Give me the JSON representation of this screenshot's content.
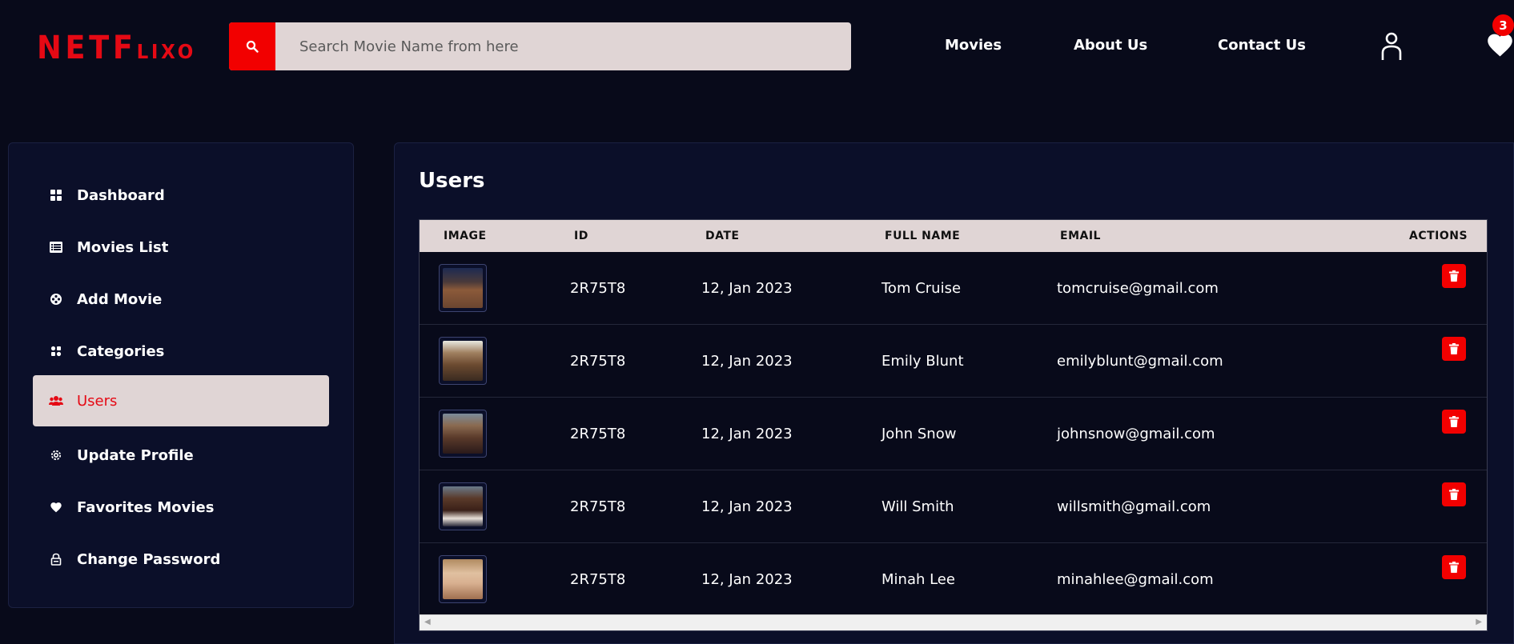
{
  "header": {
    "logo_main": "NETF",
    "logo_small": "LIXO",
    "search_placeholder": "Search Movie Name from here",
    "nav": [
      "Movies",
      "About Us",
      "Contact Us"
    ],
    "favorites_count": "3"
  },
  "sidebar": {
    "items": [
      {
        "label": "Dashboard",
        "icon": "dashboard-icon"
      },
      {
        "label": "Movies List",
        "icon": "list-icon"
      },
      {
        "label": "Add Movie",
        "icon": "film-reel-icon"
      },
      {
        "label": "Categories",
        "icon": "categories-icon"
      },
      {
        "label": "Users",
        "icon": "users-icon",
        "active": true
      },
      {
        "label": "Update Profile",
        "icon": "gear-icon"
      },
      {
        "label": "Favorites Movies",
        "icon": "heart-icon"
      },
      {
        "label": "Change Password",
        "icon": "lock-icon"
      }
    ]
  },
  "main": {
    "title": "Users",
    "columns": [
      "IMAGE",
      "ID",
      "DATE",
      "FULL NAME",
      "EMAIL",
      "ACTIONS"
    ],
    "rows": [
      {
        "id": "2R75T8",
        "date": "12, Jan 2023",
        "name": "Tom Cruise",
        "email": "tomcruise@gmail.com"
      },
      {
        "id": "2R75T8",
        "date": "12, Jan 2023",
        "name": "Emily Blunt",
        "email": "emilyblunt@gmail.com"
      },
      {
        "id": "2R75T8",
        "date": "12, Jan 2023",
        "name": "John Snow",
        "email": "johnsnow@gmail.com"
      },
      {
        "id": "2R75T8",
        "date": "12, Jan 2023",
        "name": "Will Smith",
        "email": "willsmith@gmail.com"
      },
      {
        "id": "2R75T8",
        "date": "12, Jan 2023",
        "name": "Minah Lee",
        "email": "minahlee@gmail.com"
      }
    ]
  },
  "colors": {
    "accent": "#f20000",
    "background": "#080a1a",
    "panel": "#0b0f29",
    "light": "#e0d5d5"
  }
}
